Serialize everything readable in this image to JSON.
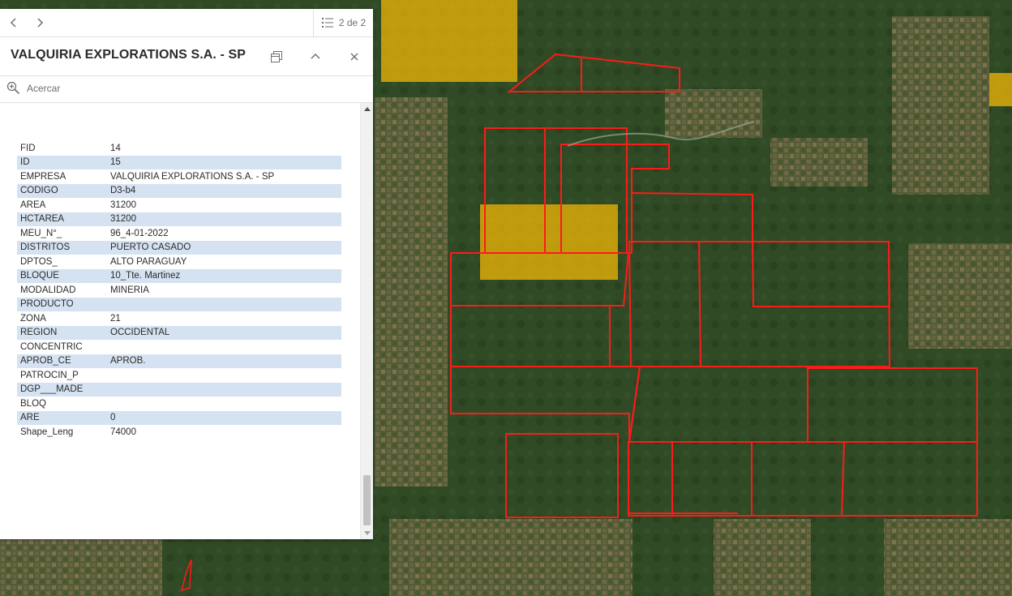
{
  "navigation": {
    "page_indicator": "2 de 2"
  },
  "popup": {
    "title": "VALQUIRIA EXPLORATIONS S.A. - SP",
    "zoom_label": "Acercar",
    "attributes": [
      {
        "field": "FID",
        "value": "14"
      },
      {
        "field": "ID",
        "value": "15"
      },
      {
        "field": "EMPRESA",
        "value": "VALQUIRIA EXPLORATIONS S.A. - SP"
      },
      {
        "field": "CODIGO",
        "value": "D3-b4"
      },
      {
        "field": "AREA",
        "value": "31200"
      },
      {
        "field": "HCTAREA",
        "value": "31200"
      },
      {
        "field": "MEU_N°_",
        "value": "96_4-01-2022"
      },
      {
        "field": "DISTRITOS",
        "value": "PUERTO CASADO"
      },
      {
        "field": "DPTOS_",
        "value": "ALTO PARAGUAY"
      },
      {
        "field": "BLOQUE",
        "value": "10_Tte. Martinez"
      },
      {
        "field": "MODALIDAD",
        "value": "MINERIA"
      },
      {
        "field": "PRODUCTO",
        "value": ""
      },
      {
        "field": "ZONA",
        "value": "21"
      },
      {
        "field": "REGION",
        "value": "OCCIDENTAL"
      },
      {
        "field": "CONCENTRIC",
        "value": ""
      },
      {
        "field": "APROB_CE",
        "value": "APROB."
      },
      {
        "field": "PATROCIN_P",
        "value": ""
      },
      {
        "field": "DGP___MADE",
        "value": ""
      },
      {
        "field": "BLOQ",
        "value": ""
      },
      {
        "field": "ARE",
        "value": "0"
      },
      {
        "field": "Shape_Leng",
        "value": "74000"
      }
    ]
  },
  "map": {
    "base_color": "#2f4a24",
    "boundary_color": "#ff1a1a",
    "highlight_color": "#f2b705"
  },
  "icons": [
    "chevron-left-icon",
    "chevron-right-icon",
    "list-icon",
    "dock-icon",
    "chevron-up-icon",
    "close-icon",
    "zoom-in-icon"
  ]
}
